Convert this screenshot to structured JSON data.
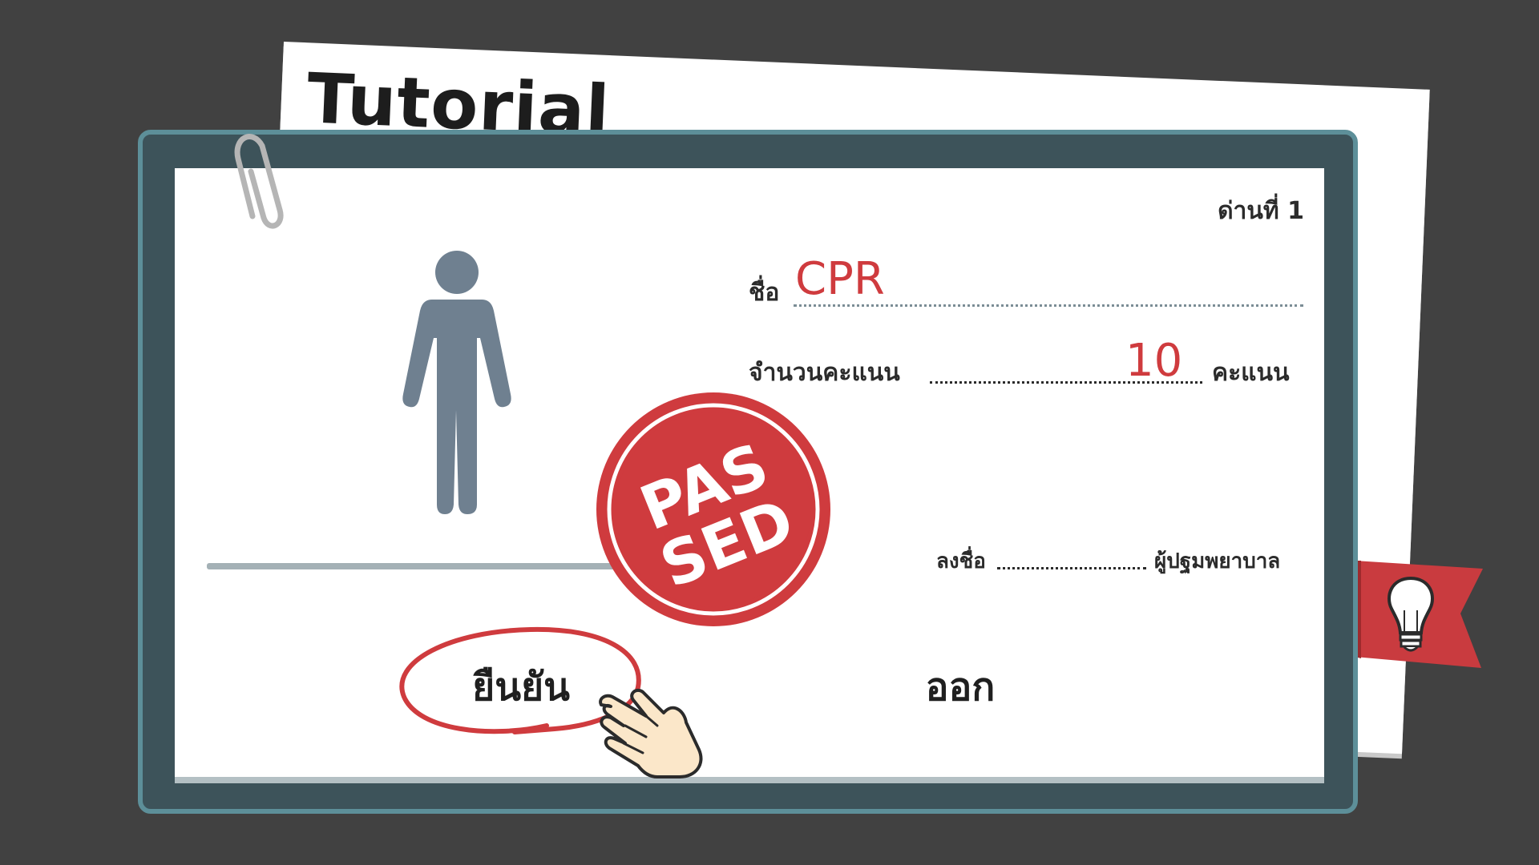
{
  "tutorial_sheet": {
    "title": "Tutorial"
  },
  "card": {
    "level_label": "ด่านที่ 1",
    "name_label": "ชื่อ",
    "name_value": "CPR",
    "score_label": "จำนวนคะแนน",
    "score_value": "10",
    "score_unit": "คะแนน",
    "sign_label": "ลงชื่อ",
    "sign_role": "ผู้ปฐมพยาบาล",
    "stamp_text": "PASSED"
  },
  "buttons": {
    "confirm_label": "ยืนยัน",
    "exit_label": "ออก"
  },
  "icons": {
    "hint": "lightbulb-icon",
    "pointer": "pointing-hand-icon",
    "clip": "paperclip-icon",
    "figure": "person-icon"
  },
  "colors": {
    "background": "#414141",
    "board": "#3d535a",
    "board_border": "#5d8f99",
    "accent_red": "#cf3b3e",
    "figure": "#6f8090"
  }
}
